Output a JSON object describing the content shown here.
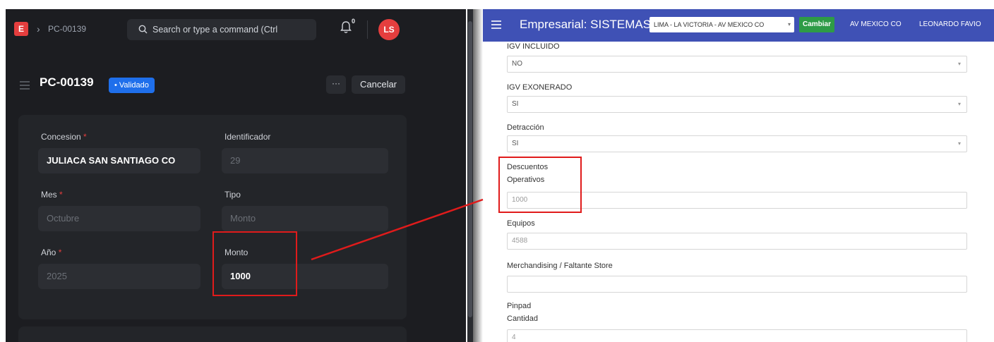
{
  "left_app": {
    "logo": "E",
    "breadcrumb": "PC-00139",
    "search_placeholder": "Search or type a command (Ctrl",
    "notification_count": "0",
    "avatar": "LS",
    "doc_title": "PC-00139",
    "status_badge": "• Validado",
    "more_label": "···",
    "cancel_label": "Cancelar",
    "fields": {
      "concesion_label": "Concesion",
      "concesion_value": "JULIACA SAN SANTIAGO CO",
      "identificador_label": "Identificador",
      "identificador_value": "29",
      "mes_label": "Mes",
      "mes_value": "Octubre",
      "tipo_label": "Tipo",
      "tipo_value": "Monto",
      "anio_label": "Año",
      "anio_value": "2025",
      "monto_label": "Monto",
      "monto_value": "1000"
    },
    "required_mark": "*"
  },
  "right_app": {
    "nav_title": "Empresarial: SISTEMAS",
    "location_select": "LIMA - LA VICTORIA - AV MEXICO CO",
    "cambiar_label": "Cambiar",
    "store_label": "AV MEXICO CO",
    "user_label": "LEONARDO FAVIO",
    "fields": {
      "igv_incluido_label": "IGV INCLUIDO",
      "igv_incluido_value": "NO",
      "igv_exonerado_label": "IGV EXONERADO",
      "igv_exonerado_value": "SI",
      "detraccion_label": "Detracción",
      "detraccion_value": "SI",
      "descuentos_label_1": "Descuentos",
      "descuentos_label_2": "Operativos",
      "descuentos_value": "1000",
      "equipos_label": "Equipos",
      "equipos_value": "4588",
      "merch_label": "Merchandising / Faltante Store",
      "merch_value": "",
      "pinpad_label": "Pinpad",
      "cantidad_label": "Cantidad",
      "cantidad_value": "4"
    }
  },
  "colors": {
    "dark_bg": "#1c1d21",
    "nav_blue": "#3f51b5",
    "badge_blue": "#1f6feb",
    "highlight_red": "#e01b1b",
    "avatar_red": "#e53e3e",
    "cambiar_green": "#2e9b46"
  },
  "icons": [
    "logo-icon",
    "chevron-right-icon",
    "search-icon",
    "bell-icon",
    "menu-icon",
    "dropdown-caret-icon"
  ]
}
